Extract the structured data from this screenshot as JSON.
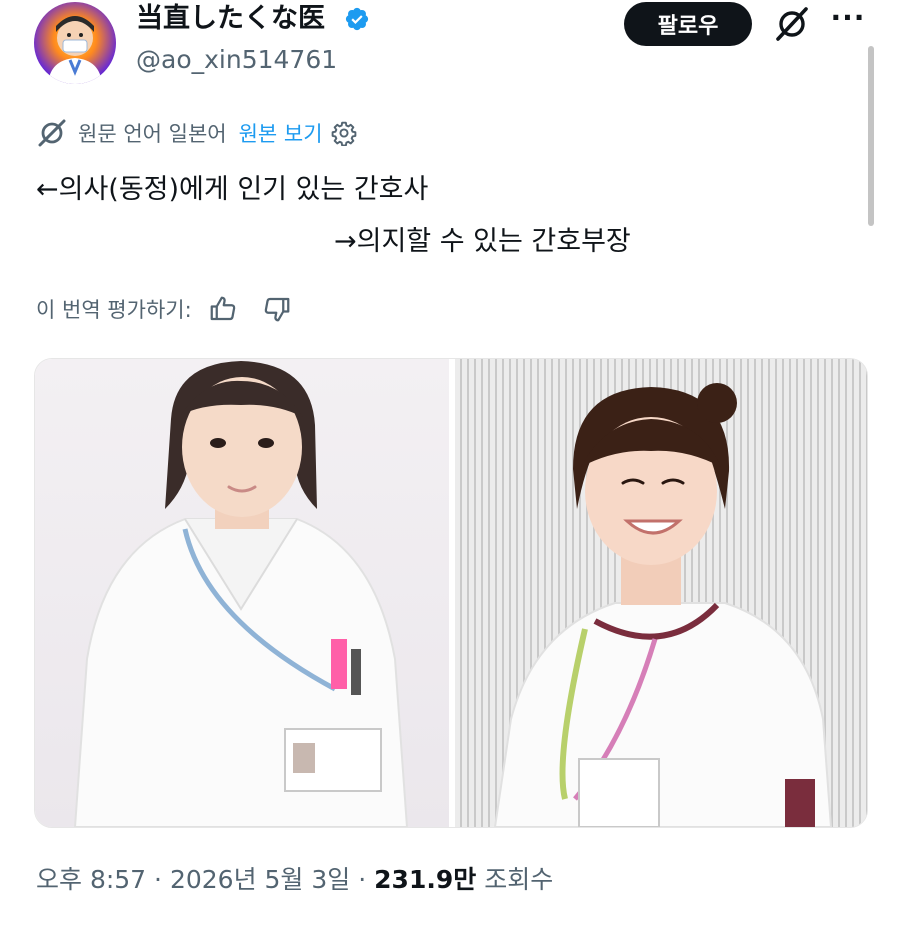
{
  "author": {
    "display_name": "当直したくな医",
    "handle": "@ao_xin514761",
    "verified_icon": "verified-badge-icon",
    "avatar_icon": "cartoon-doctor-avatar"
  },
  "header": {
    "follow_label": "팔로우",
    "more_label": "···"
  },
  "translation": {
    "source_text": "원문 언어 일본어",
    "show_original": "원본 보기"
  },
  "tweet": {
    "line1": "←의사(동정)에게 인기 있는 간호사",
    "line2": "→의지할 수 있는 간호부장"
  },
  "rating": {
    "label": "이 번역 평가하기:"
  },
  "meta": {
    "time": "오후 8:57",
    "date": "2026년 5월 3일",
    "views": "231.9만",
    "views_label": "조회수"
  },
  "colors": {
    "text_primary": "#0f1419",
    "text_secondary": "#536471",
    "link_blue": "#1d9bf0",
    "button_dark": "#0f1419"
  }
}
